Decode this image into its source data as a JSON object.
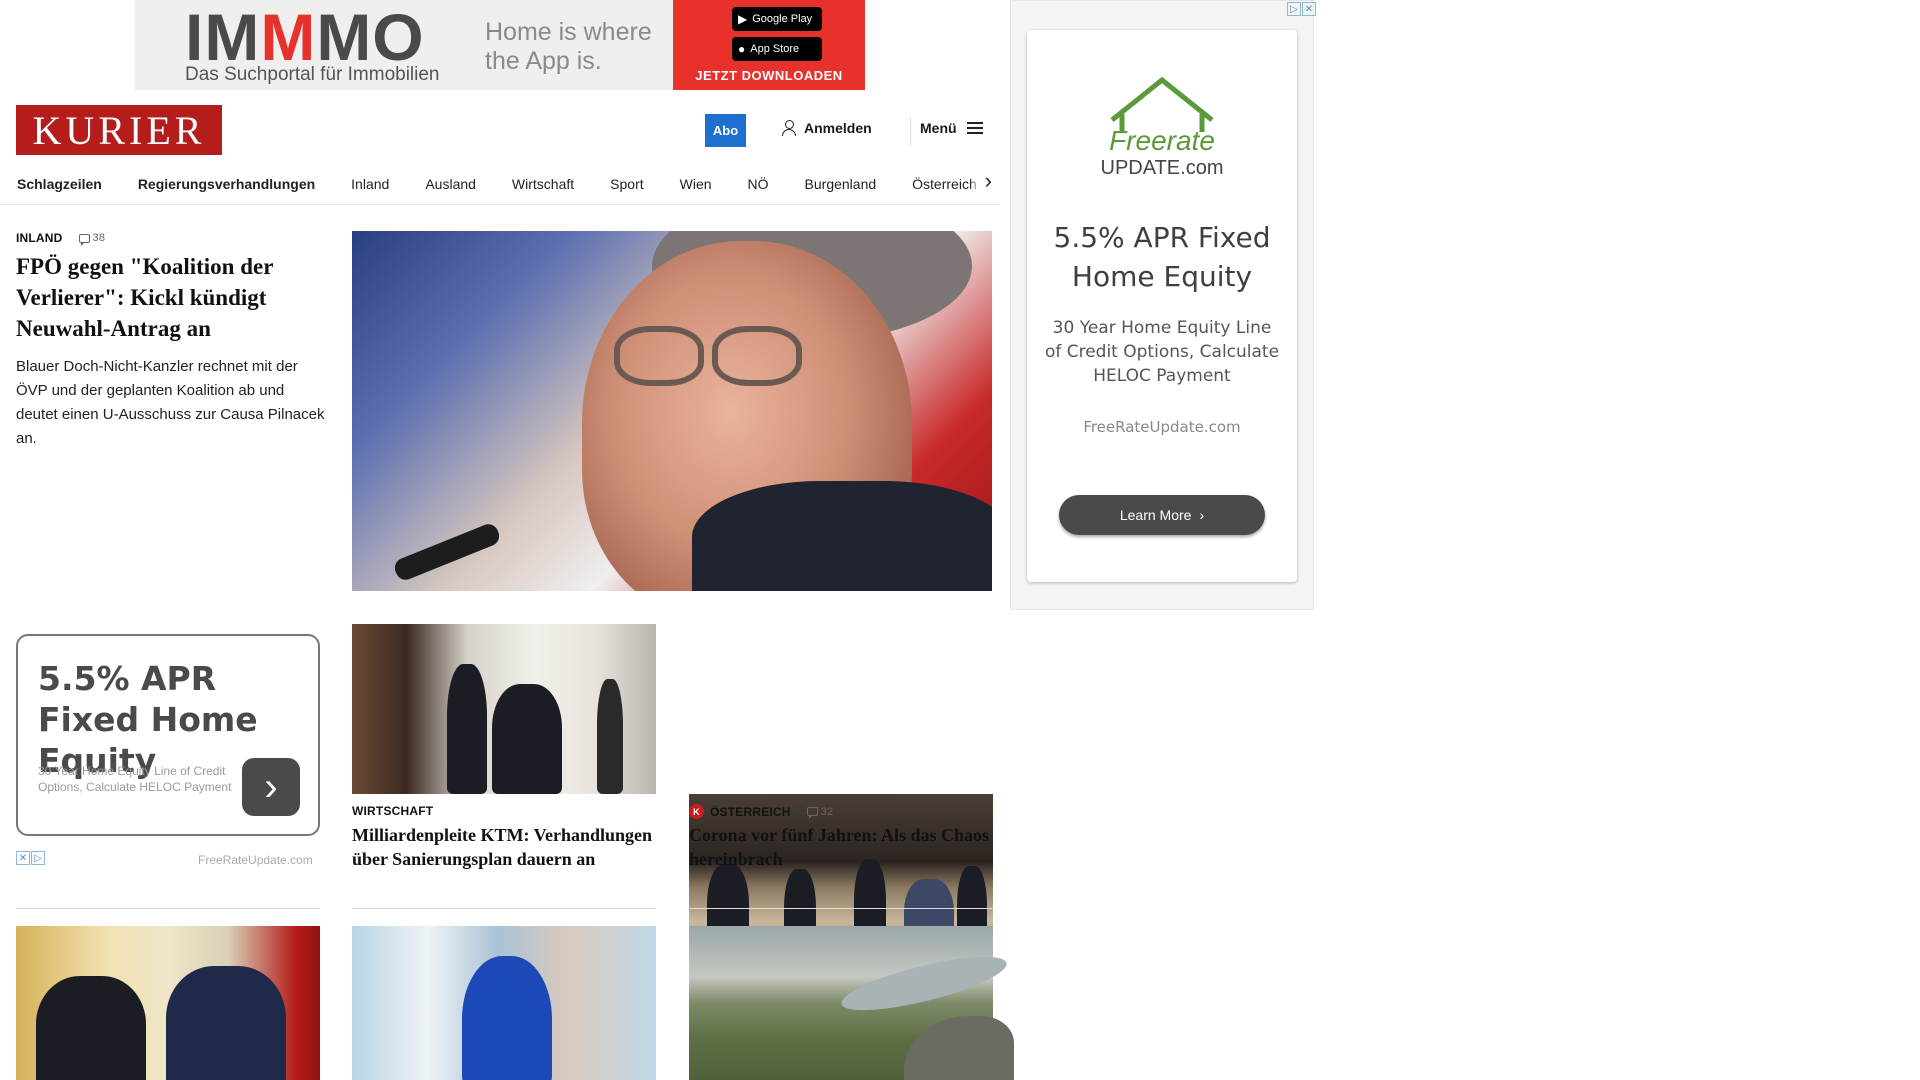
{
  "top_ad": {
    "brand_prefix": "IM",
    "brand_m": "M",
    "brand_suffix": "MO",
    "brand_sub": "Das Suchportal für Immobilien",
    "slogan": "Home is where the App is.",
    "google_play": "Google Play",
    "app_store": "App Store",
    "cta": "JETZT DOWNLOADEN"
  },
  "header": {
    "logo": "KURIER",
    "abo": "Abo",
    "login": "Anmelden",
    "menu": "Menü"
  },
  "nav": {
    "items": [
      "Schlagzeilen",
      "Regierungsverhandlungen",
      "Inland",
      "Ausland",
      "Wirtschaft",
      "Sport",
      "Wien",
      "NÖ",
      "Burgenland",
      "Österreich"
    ]
  },
  "lead": {
    "kicker": "INLAND",
    "comments": "38",
    "title": "FPÖ gegen \"Koalition der Verlierer\": Kickl kündigt Neuwahl-Antrag an",
    "teaser": "Blauer Doch-Nicht-Kanzler rechnet mit der ÖVP und der geplanten Koalition ab und deutet einen U-Ausschuss zur Causa Pilnacek an."
  },
  "box_ad": {
    "title": "5.5% APR Fixed Home Equity",
    "desc": "30 Year Home Equity Line of Credit Options, Calculate HELOC Payment",
    "url": "FreeRateUpdate.com"
  },
  "cards": [
    {
      "kicker": "WIRTSCHAFT",
      "title": "Milliardenpleite KTM: Verhandlungen über Sanierungsplan dauern an"
    },
    {
      "kicker": "ÖSTERREICH",
      "badge": "K",
      "comments": "32",
      "title": "Corona vor fünf Jahren: Als das Chaos hereinbrach"
    }
  ],
  "side_ad": {
    "logo_top": "Freerate",
    "logo_bottom": "UPDATE.com",
    "title": "5.5% APR Fixed Home Equity",
    "desc": "30 Year Home Equity Line of Credit Options, Calculate HELOC Payment",
    "url": "FreeRateUpdate.com",
    "button": "Learn More"
  },
  "colors": {
    "brand_red": "#b51c1c",
    "abo_blue": "#1f6fd1",
    "ad_red": "#e8312b"
  },
  "icons": [
    "user-icon",
    "menu-icon",
    "chevron-right-icon",
    "comment-icon",
    "adchoices-icon",
    "close-icon"
  ]
}
